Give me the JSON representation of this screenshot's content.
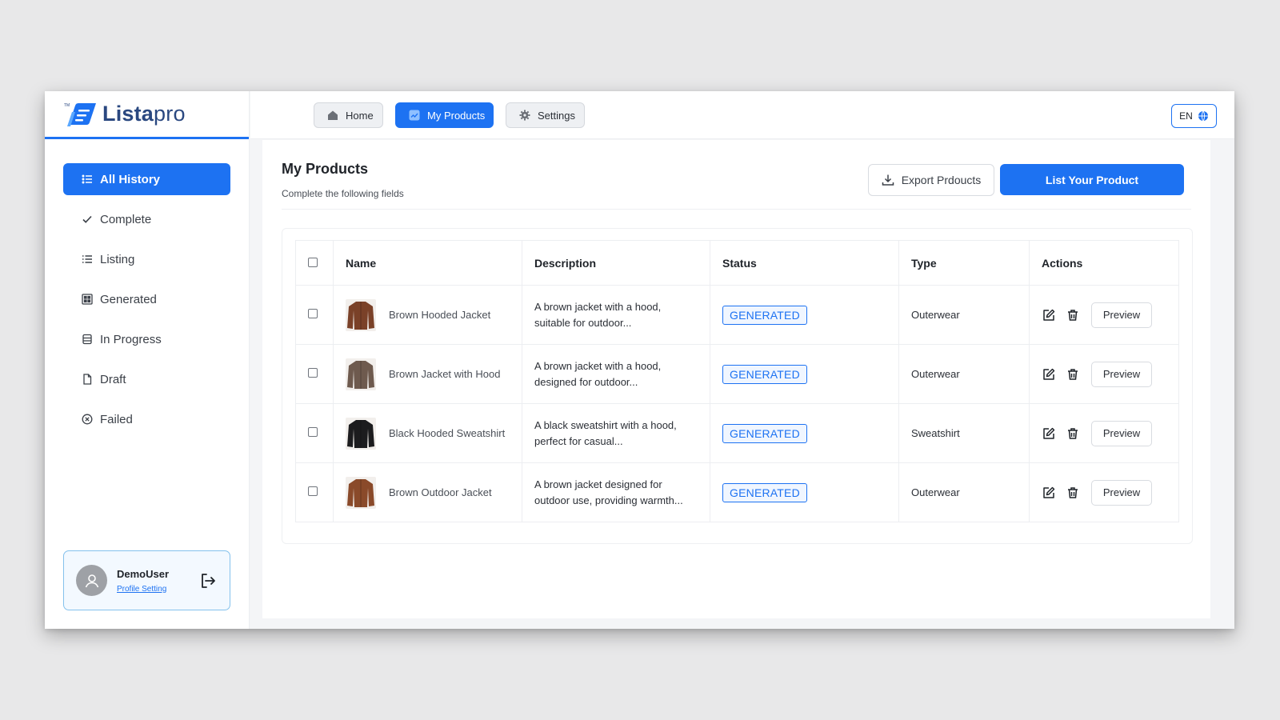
{
  "app": {
    "logo_main": "Lista",
    "logo_suffix": "pro",
    "tm": "TM"
  },
  "topnav": {
    "tabs": [
      {
        "label": "Home",
        "icon": "home-icon"
      },
      {
        "label": "My Products",
        "icon": "chart-icon",
        "active": true
      },
      {
        "label": "Settings",
        "icon": "gear-icon"
      }
    ],
    "language": "EN"
  },
  "sidebar": {
    "items": [
      {
        "label": "All History",
        "icon": "list-icon",
        "active": true
      },
      {
        "label": "Complete",
        "icon": "check-icon"
      },
      {
        "label": "Listing",
        "icon": "bullet-list-icon"
      },
      {
        "label": "Generated",
        "icon": "grid-icon"
      },
      {
        "label": "In Progress",
        "icon": "stack-icon"
      },
      {
        "label": "Draft",
        "icon": "file-icon"
      },
      {
        "label": "Failed",
        "icon": "x-circle-icon"
      }
    ],
    "user": {
      "name": "DemoUser",
      "profile_link": "Profile Setting"
    }
  },
  "main": {
    "title": "My Products",
    "subtitle": "Complete the following fields",
    "export_label": "Export Prdoucts",
    "list_label": "List Your Product",
    "table": {
      "headers": {
        "name": "Name",
        "description": "Description",
        "status": "Status",
        "type": "Type",
        "actions": "Actions"
      },
      "rows": [
        {
          "name": "Brown Hooded Jacket",
          "description": "A brown jacket with a hood, suitable for outdoor...",
          "status": "GENERATED",
          "type": "Outerwear",
          "preview": "Preview",
          "thumb_color": "#7a4128"
        },
        {
          "name": "Brown Jacket with Hood",
          "description": "A brown jacket with a hood, designed for outdoor...",
          "status": "GENERATED",
          "type": "Outerwear",
          "preview": "Preview",
          "thumb_color": "#6e5a4e"
        },
        {
          "name": "Black Hooded Sweatshirt",
          "description": "A black sweatshirt with a hood, perfect for casual...",
          "status": "GENERATED",
          "type": "Sweatshirt",
          "preview": "Preview",
          "thumb_color": "#1c1c1e"
        },
        {
          "name": "Brown Outdoor Jacket",
          "description": "A brown jacket designed for outdoor use, providing warmth...",
          "status": "GENERATED",
          "type": "Outerwear",
          "preview": "Preview",
          "thumb_color": "#8a4a2a"
        }
      ]
    }
  },
  "colors": {
    "accent": "#1d72f2",
    "logo_text": "#2a4880"
  }
}
